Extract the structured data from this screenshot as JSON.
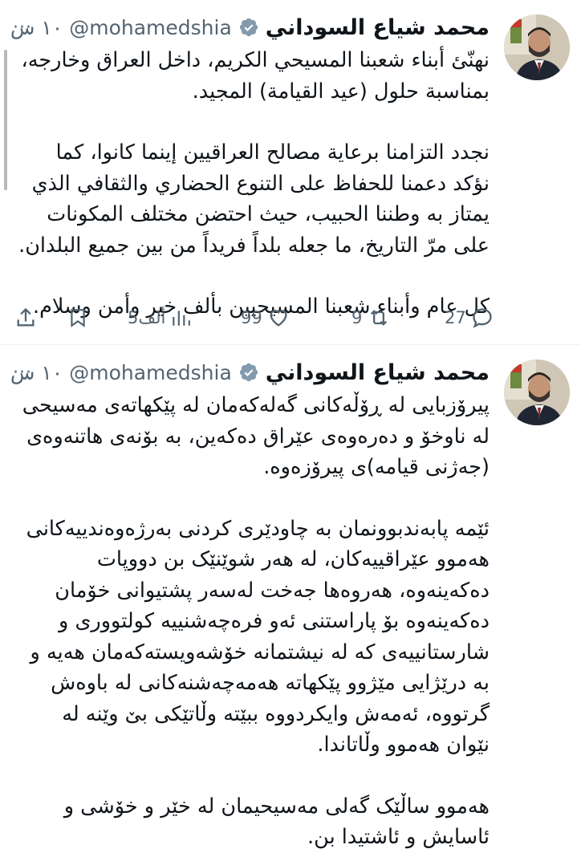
{
  "colors": {
    "text": "#0f1419",
    "muted": "#536471",
    "verified_badge": "#829aab",
    "divider": "#eff3f4"
  },
  "tweets": [
    {
      "display_name": "محمد شياع السوداني",
      "verified_icon": "verified-badge-icon",
      "handle": "@mohamedshia",
      "time": "١٠ س",
      "more_icon": "···",
      "paragraphs": [
        "نهنّئ أبناء شعبنا المسيحي الكريم، داخل العراق وخارجه، بمناسبة حلول (عيد القيامة) المجيد.",
        "نجدد التزامنا برعاية مصالح العراقيين إينما كانوا، كما نؤكد دعمنا للحفاظ على التنوع الحضاري والثقافي الذي يمتاز به وطننا الحبيب، حيث احتضن مختلف المكونات على مرّ التاريخ، ما جعله بلداً فريداً من بين جميع البلدان.",
        "كل عام وأبناء شعبنا المسيحيين بألف خير وأمن وسلام."
      ],
      "counts": {
        "reply": "27",
        "retweet": "9",
        "like": "99",
        "views": "5ألف"
      }
    },
    {
      "display_name": "محمد شياع السوداني",
      "verified_icon": "verified-badge-icon",
      "handle": "@mohamedshia",
      "time": "١٠ س",
      "more_icon": "···",
      "paragraphs": [
        "پیرۆزبایی لە ڕۆڵەکانی گەلەکەمان لە پێکهاتەی مەسیحی لە ناوخۆ و دەرەوەی عێراق دەکەین، بە بۆنەی هاتنەوەی (جەژنی قیامە)ی پیرۆزەوە.",
        "ئێمە پابەندبوونمان بە چاودێری کردنی بەرژەوەندییەکانی هەموو عێراقییەکان، لە هەر شوێنێک بن دووپات دەکەینەوە، هەروەها جەخت لەسەر پشتیوانی خۆمان دەکەینەوە بۆ پاراستنی ئەو فرەچەشنییە کولتووری و شارستانییەی کە لە نیشتمانە خۆشەویستەکەمان هەیە و بە درێژایی مێژوو پێکهاتە هەمەچەشنەکانی لە باوەش گرتووە، ئەمەش وایکردووە ببێتە وڵاتێکی بێ وێنە لە نێوان هەموو وڵاتاندا.",
        "هەموو ساڵێک گەلی مەسیحیمان لە خێر و خۆشی و ئاسایش و ئاشتیدا بن."
      ]
    }
  ]
}
